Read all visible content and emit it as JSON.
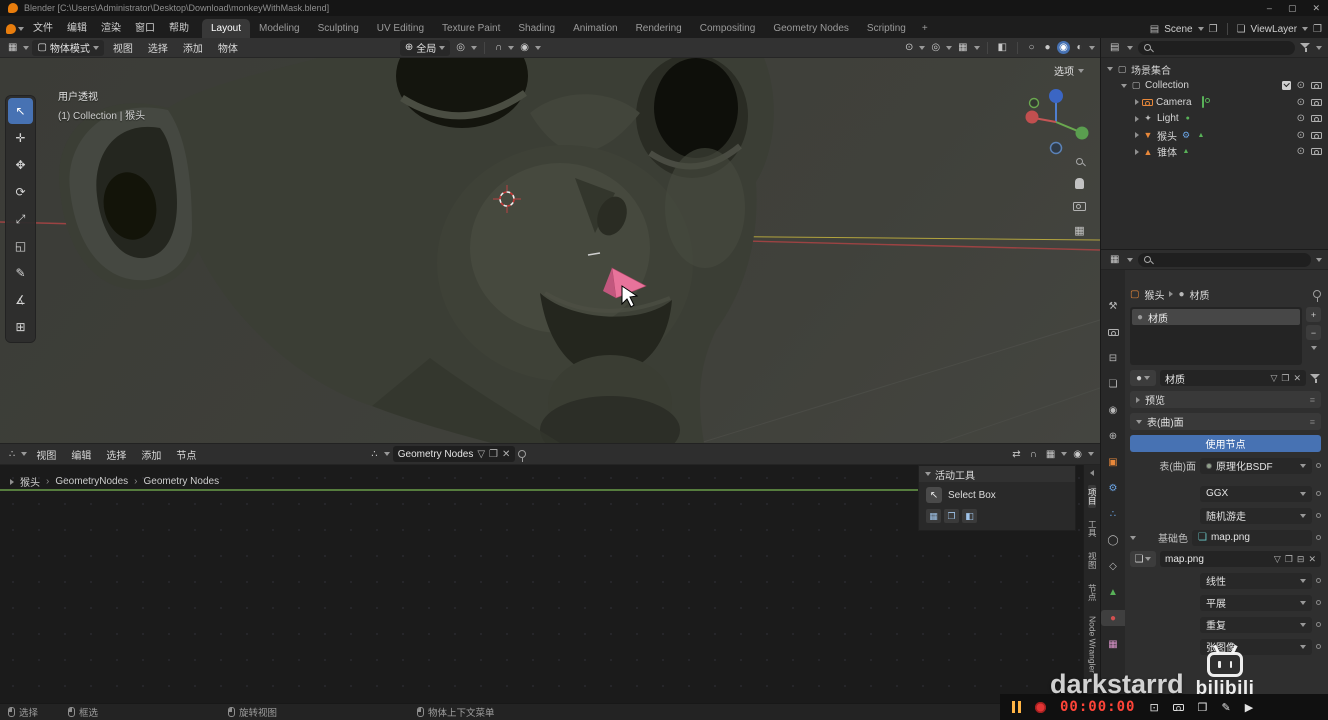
{
  "window": {
    "title": "Blender [C:\\Users\\Administrator\\Desktop\\Download\\monkeyWithMask.blend]",
    "controls": {
      "minimize": "–",
      "maximize": "▢",
      "close": "✕"
    }
  },
  "topbar": {
    "menus": [
      "文件",
      "编辑",
      "渲染",
      "窗口",
      "帮助"
    ],
    "workspaces": [
      "Layout",
      "Modeling",
      "Sculpting",
      "UV Editing",
      "Texture Paint",
      "Shading",
      "Animation",
      "Rendering",
      "Compositing",
      "Geometry Nodes",
      "Scripting"
    ],
    "active_workspace": "Layout",
    "add_label": "+",
    "scene_label": "Scene",
    "viewlayer_label": "ViewLayer"
  },
  "viewport": {
    "header": {
      "mode": "物体模式",
      "menus": [
        "视图",
        "选择",
        "添加",
        "物体"
      ],
      "orientation": "全局"
    },
    "overlay": {
      "view_name": "用户透视",
      "active_info": "(1) Collection | 猴头",
      "options_label": "选项"
    }
  },
  "toolbar": {
    "tools": [
      {
        "name": "select-box",
        "icon": "↖",
        "active": true
      },
      {
        "name": "cursor",
        "icon": "✛"
      },
      {
        "name": "move",
        "icon": "✥"
      },
      {
        "name": "rotate",
        "icon": "⟳"
      },
      {
        "name": "scale",
        "icon": "⤢"
      },
      {
        "name": "transform",
        "icon": "◱"
      },
      {
        "name": "annotate",
        "icon": "✎"
      },
      {
        "name": "measure",
        "icon": "∡"
      },
      {
        "name": "add-cube",
        "icon": "⊞"
      }
    ]
  },
  "outliner": {
    "rows": [
      {
        "label": "场景集合"
      },
      {
        "label": "Collection"
      },
      {
        "label": "Camera"
      },
      {
        "label": "Light"
      },
      {
        "label": "猴头"
      },
      {
        "label": "锥体"
      }
    ]
  },
  "node_editor": {
    "menus": [
      "视图",
      "编辑",
      "选择",
      "添加",
      "节点"
    ],
    "datablock": "Geometry Nodes",
    "breadcrumb": [
      "猴头",
      "GeometryNodes",
      "Geometry Nodes"
    ],
    "panel": {
      "title": "活动工具",
      "tool": "Select Box"
    },
    "side_tabs": [
      "项目",
      "工具",
      "视图",
      "节点",
      "Node Wrangler"
    ]
  },
  "properties": {
    "context": [
      "猴头",
      "材质"
    ],
    "slot_name": "材质",
    "datablock_name": "材质",
    "sections": {
      "preview": "预览",
      "surface": "表(曲)面"
    },
    "use_nodes": "使用节点",
    "surface_rows": [
      {
        "label": "表(曲)面",
        "value": "原理化BSDF"
      },
      {
        "label": "",
        "value": "GGX"
      },
      {
        "label": "",
        "value": "随机游走"
      },
      {
        "label": "基础色",
        "value": "map.png"
      }
    ],
    "image_name": "map.png",
    "image_settings": [
      "线性",
      "平展",
      "重复",
      "张图像"
    ],
    "nav": [
      {
        "name": "tool",
        "icon": "⚒"
      },
      {
        "name": "render",
        "icon": ""
      },
      {
        "name": "output",
        "icon": "⊟"
      },
      {
        "name": "view-layer",
        "icon": "❏"
      },
      {
        "name": "scene",
        "icon": "◉"
      },
      {
        "name": "world",
        "icon": "⊕"
      },
      {
        "name": "object",
        "icon": "▣"
      },
      {
        "name": "modifiers",
        "icon": "⚙"
      },
      {
        "name": "particles",
        "icon": "∴"
      },
      {
        "name": "physics",
        "icon": "◯"
      },
      {
        "name": "constraints",
        "icon": "◇"
      },
      {
        "name": "object-data",
        "icon": "▲"
      },
      {
        "name": "material",
        "icon": "●"
      },
      {
        "name": "texture",
        "icon": "▦"
      }
    ]
  },
  "statusbar": {
    "items": [
      "选择",
      "框选",
      "旋转视图",
      "物体上下文菜单"
    ]
  },
  "recorder": {
    "time": "00:00:00"
  },
  "watermark": {
    "text": "darkstarrd",
    "brand": "bilibili"
  },
  "icons": {
    "grid": "▦",
    "cube": "▢",
    "globe": "⊕",
    "pivot": "◎",
    "magnet": "∩",
    "proportional": "◉",
    "eye": "⊙",
    "xray": "◧",
    "wire": "○",
    "solid": "●",
    "material": "◉",
    "rendered": "◐",
    "copies": "❐",
    "close": "✕",
    "shield": "▽",
    "plus": "+",
    "minus": "−",
    "grip": "≡",
    "light": "✦",
    "mesh_obj": "▼",
    "cone": "▲",
    "mesh_data": "▲",
    "wrench": "⚙",
    "image": "❏",
    "pack": "⊟",
    "socket": "●",
    "swap": "⇄",
    "monitor": "⊡",
    "pencil": "✎",
    "play": "▶",
    "fullscreen": "❐",
    "sep": "›",
    "sphere": "●",
    "collection": "▢",
    "scene_coll": "▤",
    "node_tree": "∴"
  },
  "colors": {
    "accent": "#4772b3",
    "object_orange": "#e8883a",
    "data_green": "#58b158",
    "modifier_blue": "#6ba6e8",
    "record_red": "#e23434",
    "timer_red": "#ff4438",
    "link_green": "#567d3e",
    "axis_red": "#9c4343",
    "axis_yellow": "#b3a43e",
    "cone_pink": "#e8739b"
  }
}
